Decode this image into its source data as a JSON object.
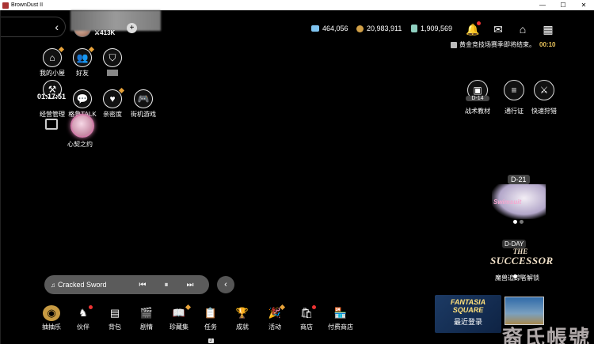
{
  "window": {
    "title": "BrownDust II",
    "controls": [
      "—",
      "☐",
      "✕"
    ]
  },
  "player": {
    "power": "⚔413K"
  },
  "currencies": [
    {
      "name": "crystal",
      "value": "464,056",
      "color": "#7fc4f0"
    },
    {
      "name": "gold",
      "value": "20,983,911",
      "color": "#d2a047"
    },
    {
      "name": "potion",
      "value": "1,909,569",
      "color": "#8fd0c0"
    }
  ],
  "top_icons": [
    "bell-icon",
    "mail-icon",
    "home-icon",
    "grid-menu-icon"
  ],
  "notice": {
    "text": "黄金竞技场赛季即将结束。",
    "timer": "00:10"
  },
  "left_menu": [
    {
      "label": "我的小屋",
      "icon": "⌂",
      "name": "my-house"
    },
    {
      "label": "好友",
      "icon": "👥",
      "name": "friends"
    },
    {
      "label": "",
      "icon": "⛉",
      "name": "guild"
    },
    {
      "label": "经营管理",
      "icon": "⚒",
      "name": "management"
    },
    {
      "label": "格鲁TALK",
      "icon": "💬",
      "name": "talk"
    },
    {
      "label": "亲密度",
      "icon": "♥",
      "name": "intimacy"
    },
    {
      "label": "街机游戏",
      "icon": "🎮",
      "name": "arcade"
    }
  ],
  "timer_text": "01:17:51",
  "heart_pact_label": "心契之约",
  "right_menu": [
    {
      "label": "战术教材",
      "stage": "D-14",
      "icon": "▣"
    },
    {
      "label": "通行证",
      "icon": "≡"
    },
    {
      "label": "快速狩猎",
      "icon": "⚔"
    }
  ],
  "event_d21": {
    "tag": "D-21",
    "text": "Swimsuit"
  },
  "dday": {
    "tag": "D-DAY",
    "title_line1": "THE",
    "title_line2": "SUCCESSOR",
    "label": "魔兽追踪者解锁"
  },
  "music": {
    "song": "Cracked Sword",
    "icon": "♫",
    "prev": "⏮",
    "pause": "⏸",
    "next": "⏭"
  },
  "bottom_menu": [
    {
      "label": "抽抽乐",
      "icon": "◉"
    },
    {
      "label": "伙伴",
      "icon": "♞"
    },
    {
      "label": "背包",
      "icon": "▤"
    },
    {
      "label": "剧情",
      "icon": "🎬"
    },
    {
      "label": "珍藏集",
      "icon": "📖"
    },
    {
      "label": "任务",
      "icon": "📋",
      "key": "J"
    },
    {
      "label": "成就",
      "icon": "🏆"
    },
    {
      "label": "活动",
      "icon": "🎉"
    },
    {
      "label": "商店",
      "icon": "🛍"
    },
    {
      "label": "付费商店",
      "icon": "🏪"
    }
  ],
  "fantasia": {
    "line1": "FANTASIA",
    "line2": "SQUARE",
    "label": "最近登录",
    "key": "F"
  },
  "watermark": "裔氏帳號"
}
